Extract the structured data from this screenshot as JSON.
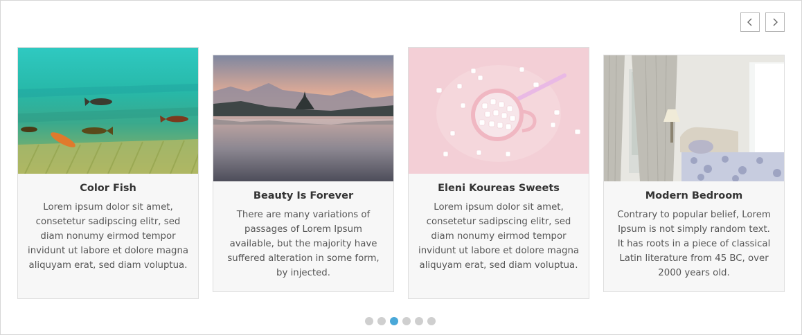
{
  "carousel": {
    "cards": [
      {
        "title": "Color Fish",
        "text": "Lorem ipsum dolor sit amet, consetetur sadipscing elitr, sed diam nonumy eirmod tempor invidunt ut labore et dolore magna aliquyam erat, sed diam voluptua."
      },
      {
        "title": "Beauty Is Forever",
        "text": "There are many variations of passages of Lorem Ipsum available, but the majority have suffered alteration in some form, by injected."
      },
      {
        "title": "Eleni Koureas Sweets",
        "text": "Lorem ipsum dolor sit amet, consetetur sadipscing elitr, sed diam nonumy eirmod tempor invidunt ut labore et dolore magna aliquyam erat, sed diam voluptua."
      },
      {
        "title": "Modern Bedroom",
        "text": "Contrary to popular belief, Lorem Ipsum is not simply random text. It has roots in a piece of classical Latin literature from 45 BC, over 2000 years old."
      }
    ],
    "pagination": {
      "pages": 6,
      "active_index": 3
    },
    "colors": {
      "active_dot": "#4aa8d8",
      "inactive_dot": "#cfcfcf"
    },
    "icons": {
      "prev": "chevron-left-icon",
      "next": "chevron-right-icon"
    }
  }
}
